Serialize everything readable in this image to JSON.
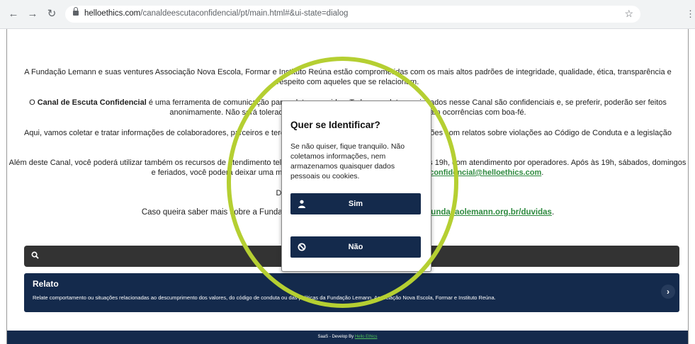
{
  "browser": {
    "back_icon": "←",
    "forward_icon": "→",
    "reload_icon": "↻",
    "url_host": "helloethics.com",
    "url_path": "/canaldeescutaconfidencial/pt/main.html#&ui-state=dialog",
    "star_icon": "☆",
    "menu_icon": "⋮"
  },
  "content": {
    "p1": "A Fundação Lemann e suas ventures Associação Nova Escola, Formar e Instituto Reúna estão comprometidas com os mais altos padrões de integridade, qualidade, ética, transparência e respeito com aqueles que se relacionam.",
    "p2_bold": "Canal de Escuta Confidencial",
    "p2_pre": "O ",
    "p2_rest": " é uma ferramenta de comunicação para relatar ocorridos. Todos os relatos registrados nesse Canal são confidenciais e, se preferir, poderão ser feitos anonimamente. Não será tolerada nenhuma retaliação daqueles que reportam ocorrências com boa-fé.",
    "p3": "Aqui, vamos coletar e tratar informações de colaboradores, parceiros e terceiros que se relacionam com as organizações com relatos sobre violações ao Código de Conduta e a legislação vigente.",
    "p4_pre": "Além deste Canal, você poderá utilizar também os recursos de atendimento telefônico, de segunda a sexta-feira das 7h às 19h, com atendimento por operadores. Após às 19h, sábados, domingos e feriados, você poderá deixar uma mensagem ou enviar um e-mail para ",
    "p4_email": "escutaconfidencial@helloethics.com",
    "p4_post": ".",
    "p5": "Desde já, agradecemos sua colaboração.",
    "p6_pre": "Caso queira saber mais sobre a Fundação Lemann, acesse nosso site: ",
    "p6_link": "https://fundacaolemann.org.br/duvidas",
    "p6_post": "."
  },
  "relato": {
    "title": "Relato",
    "description": "Relate comportamento ou situações relacionadas ao descumprimento dos valores, do código de conduta ou das políticas da Fundação Lemann, Associação Nova Escola, Formar e Instituto Reúna.",
    "chevron": "›"
  },
  "footer": {
    "prefix": "SaaS - Develop By ",
    "link": "Hello Ethics"
  },
  "dialog": {
    "title": "Quer se Identificar?",
    "text": "Se não quiser, fique tranquilo. Não coletamos informações, nem armazenamos quaisquer dados pessoais ou cookies.",
    "yes_label": "Sim",
    "no_label": "Não"
  },
  "colors": {
    "navy": "#142a4c",
    "link_green": "#2e8a3f",
    "highlight_ring": "#b5cf32"
  }
}
